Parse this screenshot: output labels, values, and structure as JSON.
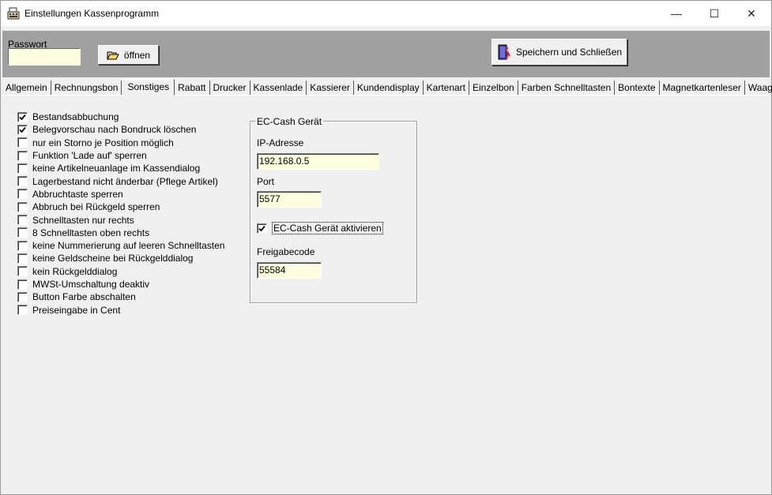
{
  "window": {
    "title": "Einstellungen Kassenprogramm",
    "icon": "cash-register-icon",
    "caption_buttons": {
      "minimize": "—",
      "maximize": "☐",
      "close": "✕"
    }
  },
  "toolbar": {
    "password_label": "Passwort",
    "password_value": "",
    "open_label": "öffnen",
    "save_close_label": "Speichern und Schließen"
  },
  "tabs": [
    {
      "label": "Allgemein"
    },
    {
      "label": "Rechnungsbon"
    },
    {
      "label": "Sonstiges",
      "active": true
    },
    {
      "label": "Rabatt"
    },
    {
      "label": "Drucker"
    },
    {
      "label": "Kassenlade"
    },
    {
      "label": "Kassierer"
    },
    {
      "label": "Kundendisplay"
    },
    {
      "label": "Kartenart"
    },
    {
      "label": "Einzelbon"
    },
    {
      "label": "Farben Schnelltasten"
    },
    {
      "label": "Bontexte"
    },
    {
      "label": "Magnetkartenleser"
    },
    {
      "label": "Waage"
    }
  ],
  "options": [
    {
      "label": "Bestandsabbuchung",
      "checked": true
    },
    {
      "label": "Belegvorschau nach Bondruck löschen",
      "checked": true
    },
    {
      "label": "nur ein Storno je Position möglich",
      "checked": false
    },
    {
      "label": "Funktion 'Lade auf' sperren",
      "checked": false
    },
    {
      "label": "keine Artikelneuanlage im Kassendialog",
      "checked": false
    },
    {
      "label": "Lagerbestand nicht änderbar (Pflege Artikel)",
      "checked": false
    },
    {
      "label": "Abbruchtaste sperren",
      "checked": false
    },
    {
      "label": "Abbruch bei Rückgeld sperren",
      "checked": false
    },
    {
      "label": "Schnelltasten nur rechts",
      "checked": false
    },
    {
      "label": "8 Schnelltasten oben rechts",
      "checked": false
    },
    {
      "label": "keine Nummerierung auf leeren Schnelltasten",
      "checked": false
    },
    {
      "label": "keine Geldscheine bei Rückgelddialog",
      "checked": false
    },
    {
      "label": "kein Rückgelddialog",
      "checked": false
    },
    {
      "label": "MWSt-Umschaltung deaktiv",
      "checked": false
    },
    {
      "label": "Button Farbe abschalten",
      "checked": false
    },
    {
      "label": "Preiseingabe in Cent",
      "checked": false
    }
  ],
  "ec_cash": {
    "group_title": "EC-Cash Gerät",
    "ip_label": "IP-Adresse",
    "ip_value": "192.168.0.5",
    "port_label": "Port",
    "port_value": "5577",
    "activate_label": "EC-Cash Gerät aktivieren",
    "activate_checked": true,
    "release_label": "Freigabecode",
    "release_value": "55584"
  }
}
